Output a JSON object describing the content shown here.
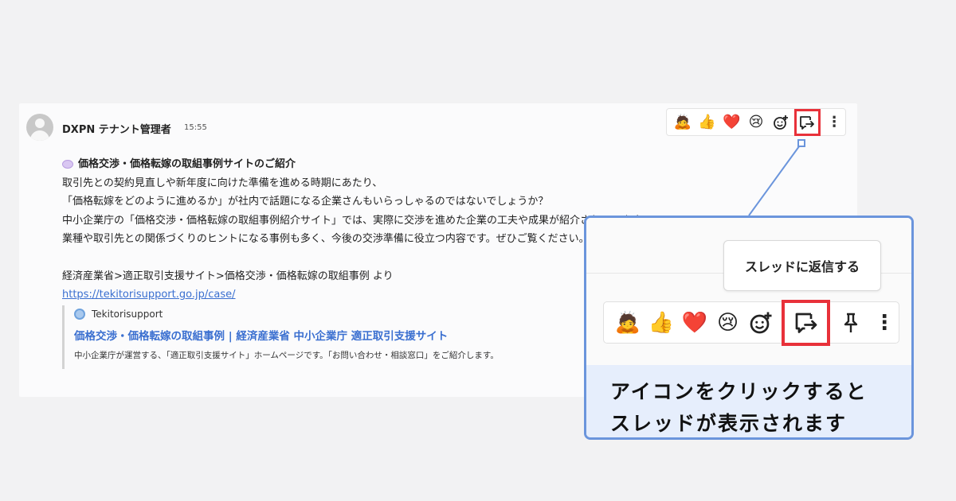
{
  "message": {
    "author": "DXPN テナント管理者",
    "time": "15:55",
    "title": "価格交渉・価格転嫁の取組事例サイトのご紹介",
    "lines": [
      "取引先との契約見直しや新年度に向けた準備を進める時期にあたり、",
      "「価格転嫁をどのように進めるか」が社内で話題になる企業さんもいらっしゃるのではないでしょうか？",
      "中小企業庁の「価格交渉・価格転嫁の取組事例紹介サイト」では、実際に交渉を進めた企業の工夫や成果が紹介されています。",
      "業種や取引先との関係づくりのヒントになる事例も多く、今後の交渉準備に役立つ内容です。ぜひご覧ください。"
    ],
    "source_line": "経済産業省>適正取引支援サイト>価格交渉・価格転嫁の取組事例 より",
    "link": "https://tekitorisupport.go.jp/case/"
  },
  "preview": {
    "site": "Tekitorisupport",
    "title": "価格交渉・価格転嫁の取組事例 | 経済産業省 中小企業庁 適正取引支援サイト",
    "description": "中小企業庁が運営する、「適正取引支援サイト」ホームページです。「お問い合わせ・相談窓口」をご紹介します。"
  },
  "reaction_bar": {
    "emojis": [
      "🙇",
      "👍",
      "❤️",
      "😢",
      "☺"
    ],
    "more": "⋮"
  },
  "callout": {
    "tooltip": "スレッドに返信する",
    "pin": "📌",
    "caption_line1": "アイコンをクリックすると",
    "caption_line2": "スレッドが表示されます"
  },
  "colors": {
    "highlight": "#e8313a",
    "callout_border": "#6b95dc",
    "link": "#3a6fd0"
  }
}
